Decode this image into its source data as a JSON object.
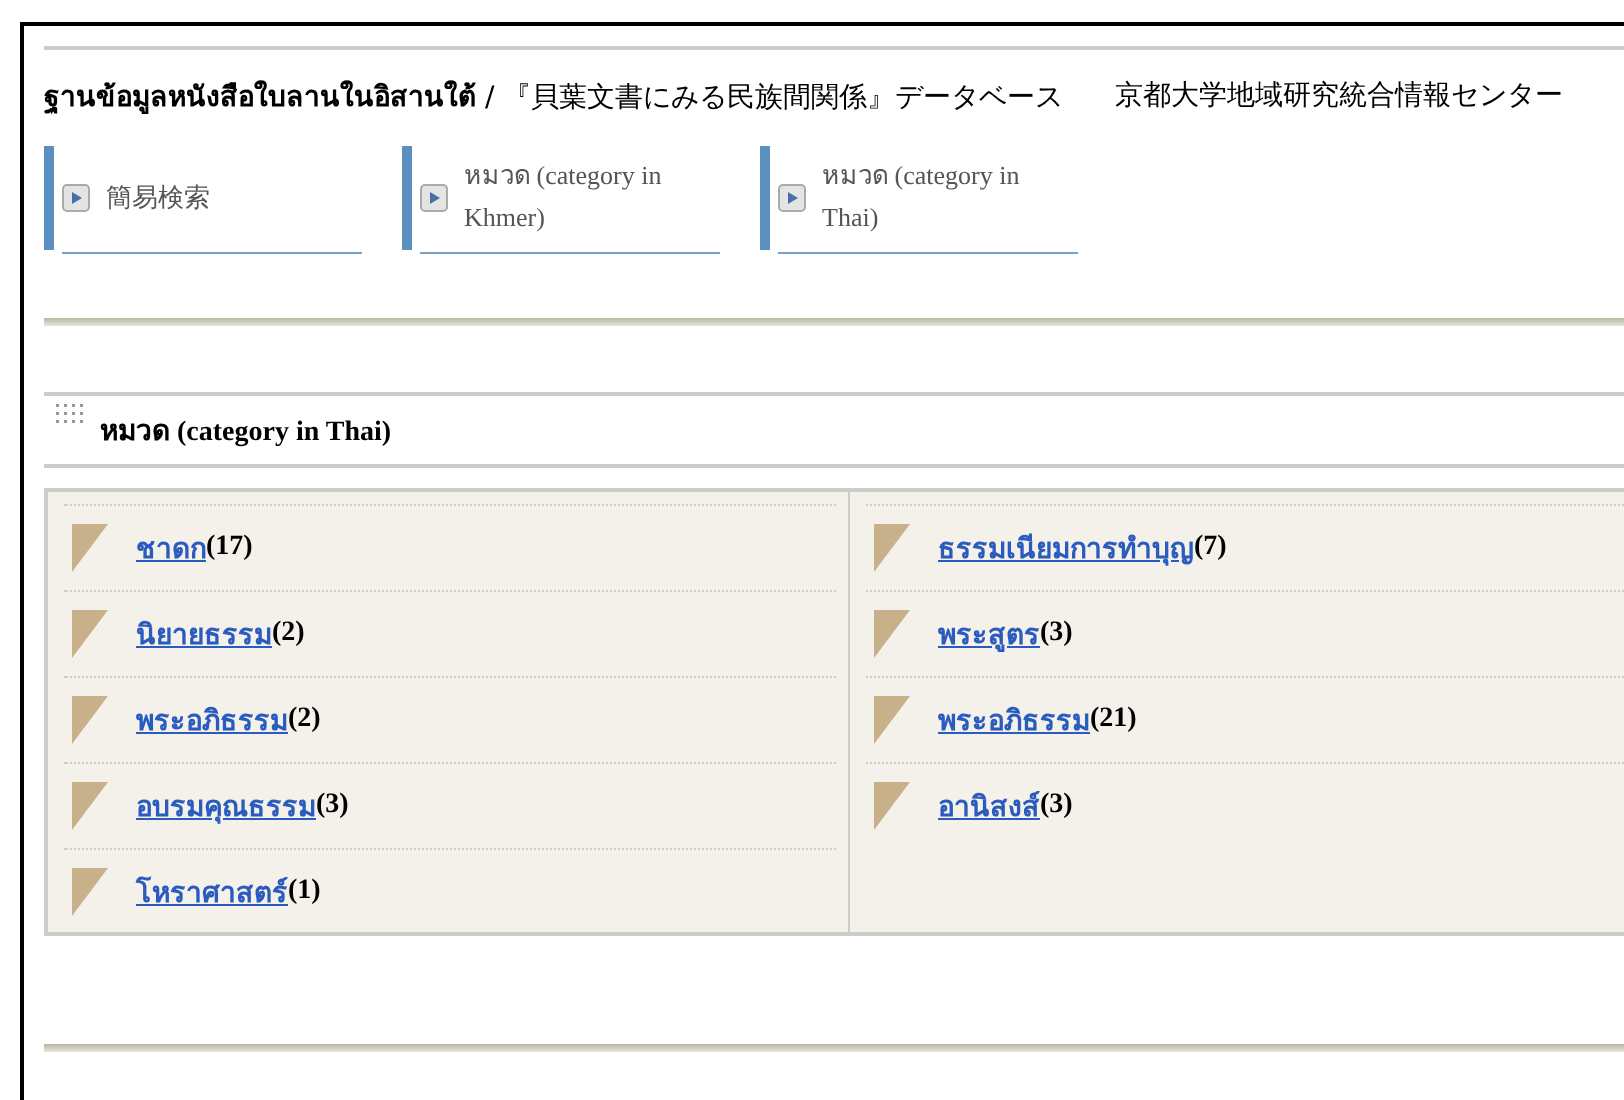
{
  "header": {
    "title": "**ฐานข้อมูลหนังสือใบลานในอิสานใต้** / 『貝葉文書にみる民族間関係』データベース",
    "organization": "京都大学地域研究統合情報センター"
  },
  "tabs": [
    {
      "label": "簡易検索"
    },
    {
      "label": "หมวด (category in Khmer)"
    },
    {
      "label": "หมวด (category in Thai)"
    }
  ],
  "section": {
    "title": "หมวด (category in Thai)"
  },
  "columns": [
    [
      {
        "label": "ชาดก",
        "count": "(17)"
      },
      {
        "label": "นิยายธรรม",
        "count": "(2)"
      },
      {
        "label": "พระอภิธรรม",
        "count": "(2)"
      },
      {
        "label": "อบรมคุณธรรม",
        "count": "(3)"
      },
      {
        "label": "โหราศาสตร์",
        "count": "(1)"
      }
    ],
    [
      {
        "label": "ธรรมเนียมการทำบุญ",
        "count": "(7)"
      },
      {
        "label": "พระสูตร",
        "count": "(3)"
      },
      {
        "label": "พระอภิธรรม",
        "count": "(21)"
      },
      {
        "label": "อานิสงส์",
        "count": "(3)"
      }
    ]
  ]
}
